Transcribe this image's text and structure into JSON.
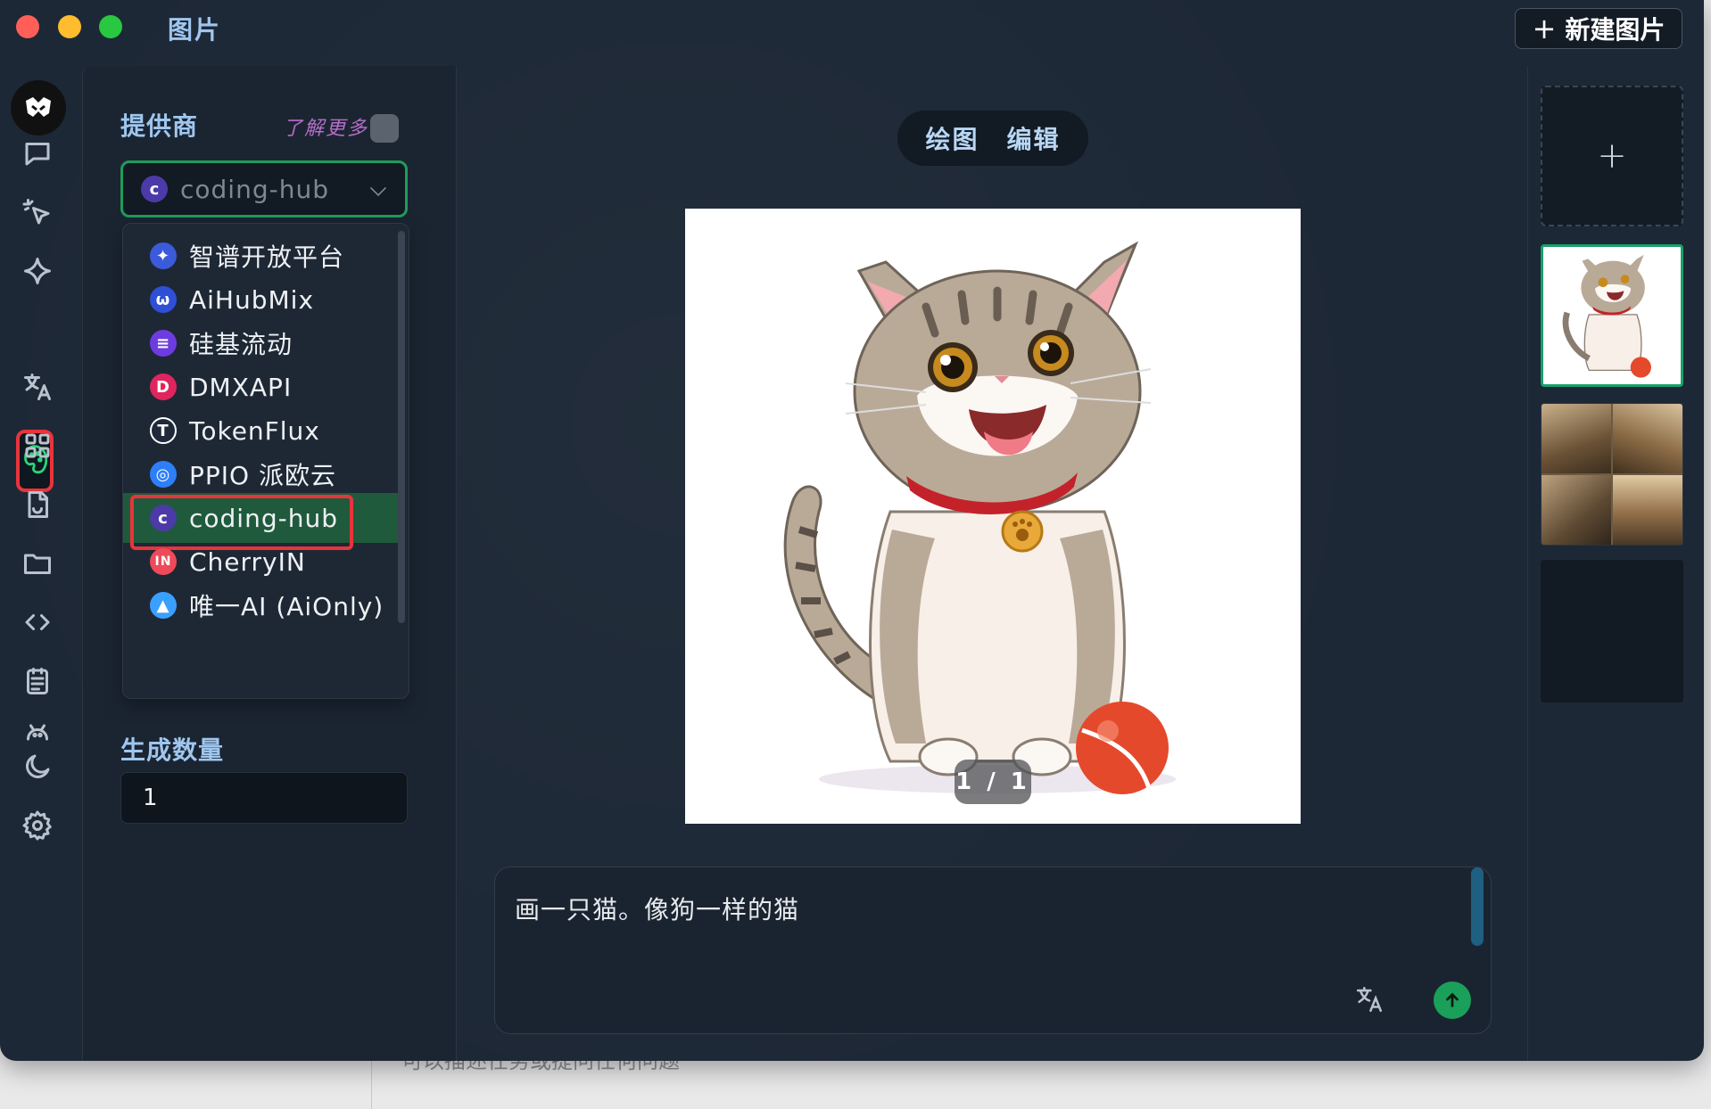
{
  "window": {
    "title": "图片",
    "new_button_label": "新建图片",
    "new_button_icon": "plus-icon"
  },
  "rail": {
    "items": [
      "chat-icon",
      "agent-cursor-icon",
      "sparkle-icon",
      "paint-palette-icon",
      "translate-icon",
      "apps-grid-icon",
      "document-icon",
      "folder-icon",
      "code-icon",
      "notes-icon",
      "bot-icon",
      "moon-icon",
      "settings-gear-icon"
    ],
    "active": "paint-palette-icon"
  },
  "panel": {
    "provider_title": "提供商",
    "learn_more": "了解更多",
    "selected_provider": "coding-hub",
    "providers": [
      {
        "label": "智谱开放平台",
        "icon_color": "#3b5bdb"
      },
      {
        "label": "AiHubMix",
        "icon_color": "#2f4fd6"
      },
      {
        "label": "硅基流动",
        "icon_color": "#6c3ce0"
      },
      {
        "label": "DMXAPI",
        "icon_color": "#e0245e"
      },
      {
        "label": "TokenFlux",
        "icon_color": "#1e2a3a"
      },
      {
        "label": "PPIO 派欧云",
        "icon_color": "#2d7ff9"
      },
      {
        "label": "coding-hub",
        "icon_color": "#4b3aa8",
        "icon_letter": "c"
      },
      {
        "label": "CherryIN",
        "icon_color": "#ef4a5a",
        "icon_letter": "IN"
      },
      {
        "label": "唯一AI (AiOnly)",
        "icon_color": "#3aa0ff"
      }
    ],
    "count_title": "生成数量",
    "count_value": "1"
  },
  "main": {
    "tabs": [
      "绘图",
      "编辑"
    ],
    "page_indicator": "1 / 1",
    "prompt_text": "画一只猫。像狗一样的猫"
  },
  "background": {
    "obscured_text": "可以描述任务或提问任何问题"
  },
  "colors": {
    "accent_green": "#1aa05a",
    "highlight_red": "#e8343b",
    "title_blue": "#9fc6ee",
    "learn_more_purple": "#b66ec8"
  }
}
